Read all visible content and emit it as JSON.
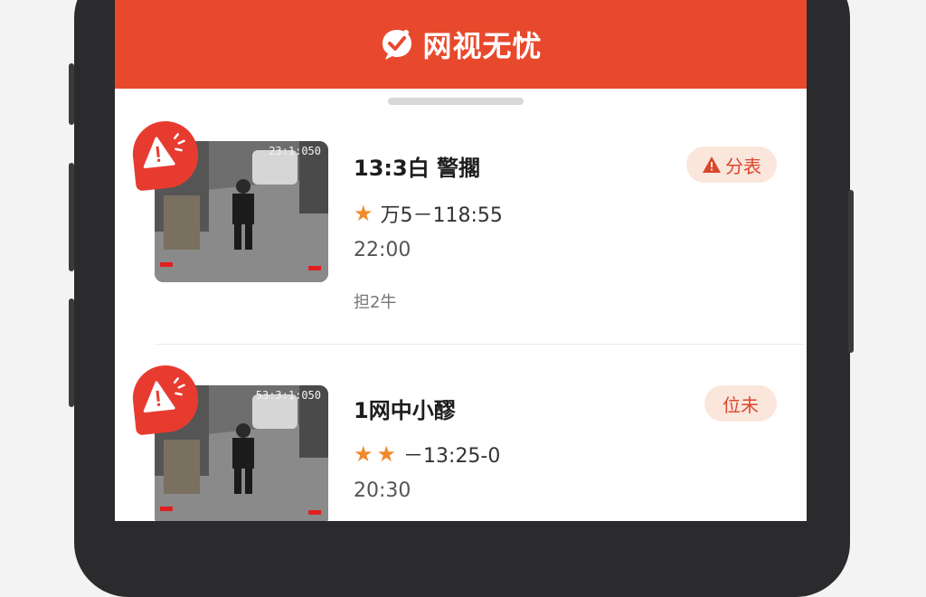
{
  "app": {
    "title": "网视无忧"
  },
  "colors": {
    "brand": "#e8492d",
    "star": "#f08a2a",
    "pill_bg": "#fbe6dc"
  },
  "events": [
    {
      "thumb_time": "23:1:050",
      "title": "13:3白 警擱",
      "rating_text": "万5－118:55",
      "stars": 1,
      "time": "22:00",
      "sub": "担2牛",
      "badge": "分表",
      "badge_icon": "warning-icon"
    },
    {
      "thumb_time": "53:3:1:050",
      "title": "1网中小醪",
      "rating_text": "－13:25-0",
      "stars": 2,
      "time": "20:30",
      "badge": "位未"
    }
  ]
}
